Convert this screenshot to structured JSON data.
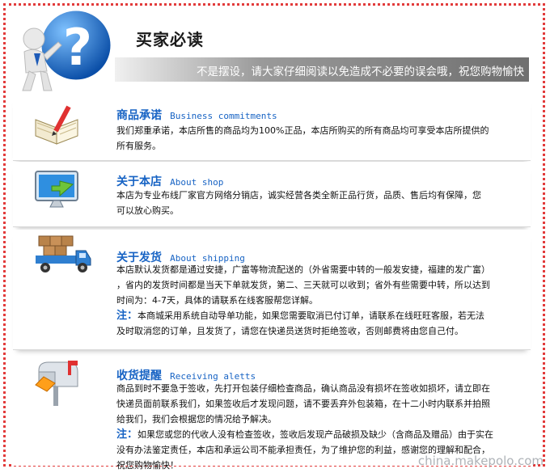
{
  "header": {
    "title": "买家必读",
    "banner": "不是摆设，请大家仔细阅读以免造成不必要的误会哦，祝您购物愉快"
  },
  "sections": [
    {
      "title_cn": "商品承诺",
      "title_en": "Business commitments",
      "lines": [
        "我们郑重承诺，本店所售的商品均为100%正品，本店所购买的所有商品均可享受本店所提供的",
        "所有服务。"
      ]
    },
    {
      "title_cn": "关于本店",
      "title_en": "About shop",
      "lines": [
        "本店为专业布线厂家官方网络分销店，诚实经营各类全新正品行货，品质、售后均有保障，您",
        "可以放心购买。"
      ]
    },
    {
      "title_cn": "关于发货",
      "title_en": "About shipping",
      "lines": [
        "本店默认发货都是通过安捷，广富等物流配送的（外省需要中转的一般发安捷，福建的发广富）",
        "，省内的发货时间都是当天下单就发货，第二、三天就可以收到；省外有些需要中转，所以达到",
        "时间为：4-7天，具体的请联系在线客服帮您详解。"
      ],
      "note_label": "注：",
      "note_lines": [
        "本商城采用系统自动导单功能，如果您需要取消已付订单，请联系在线旺旺客服，若无法",
        "及时取消您的订单，且发货了，请您在快递员送货时拒绝签收，否则邮费将由您自己付。"
      ]
    },
    {
      "title_cn": "收货提醒",
      "title_en": "Receiving aletts",
      "lines": [
        "商品到时不要急于签收，先打开包装仔细检查商品，确认商品没有损坏在签收如损坏，请立即在",
        "快递员面前联系我们，如果签收后才发现问题，请不要丢弃外包装箱，在十二小时内联系并拍照",
        "给我们，我们会根据您的情况给予解决。"
      ],
      "note_label": "注：",
      "note_lines": [
        "如果您或您的代收人没有检查签收，签收后发现产品破损及缺少（含商品及赠品）由于实在",
        "没有办法鉴定责任，本店和承运公司不能承担责任，为了维护您的利益，感谢您的理解和配合，",
        "祝您购物愉快！"
      ]
    }
  ],
  "watermark": "china.makepolo.com",
  "colors": {
    "accent": "#1763c4",
    "border": "#e23b3b",
    "banner": "#7a7a7a"
  },
  "icons": [
    "question-mascot-icon",
    "book-pen-icon",
    "monitor-icon",
    "delivery-truck-icon",
    "mailbox-icon"
  ]
}
